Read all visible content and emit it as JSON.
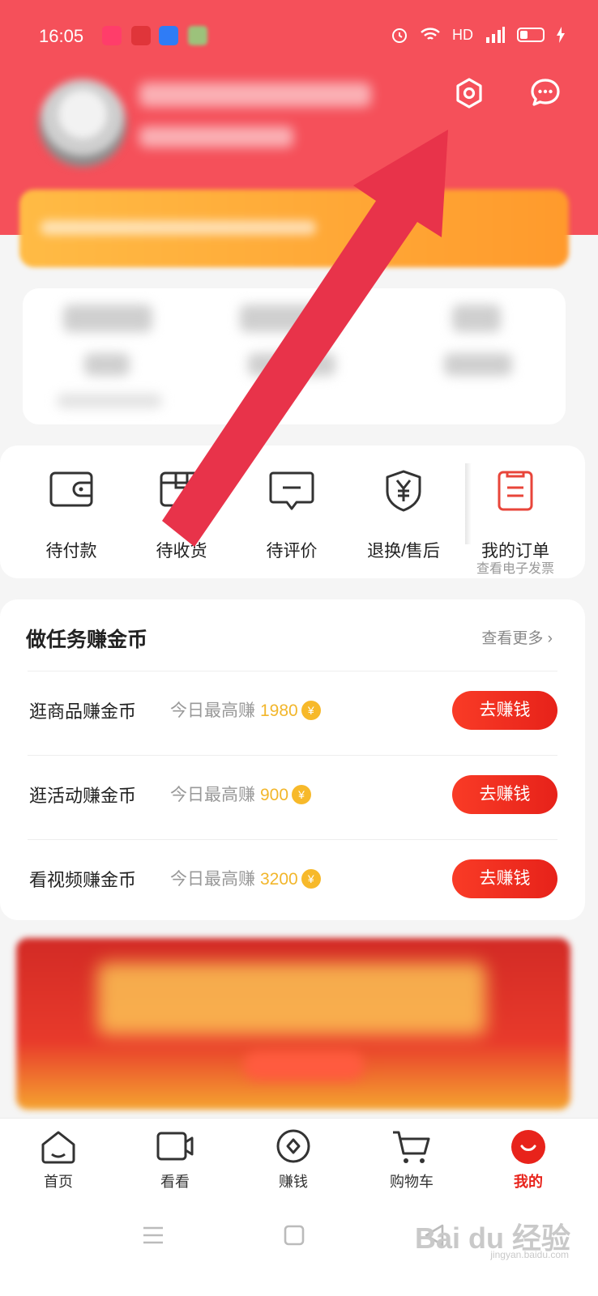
{
  "status_bar": {
    "time": "16:05",
    "hd_label": "HD"
  },
  "orders": {
    "items": [
      {
        "label": "待付款",
        "icon": "wallet-icon"
      },
      {
        "label": "待收货",
        "icon": "package-icon"
      },
      {
        "label": "待评价",
        "icon": "comment-icon"
      },
      {
        "label": "退换/售后",
        "icon": "refund-icon"
      },
      {
        "label": "我的订单",
        "sub": "查看电子发票",
        "icon": "order-list-icon"
      }
    ]
  },
  "tasks": {
    "title": "做任务赚金币",
    "more": "查看更多 ›",
    "sub_prefix": "今日最高赚",
    "coin_glyph": "¥",
    "button_label": "去赚钱",
    "rows": [
      {
        "name": "逛商品赚金币",
        "amount": "1980"
      },
      {
        "name": "逛活动赚金币",
        "amount": "900"
      },
      {
        "name": "看视频赚金币",
        "amount": "3200"
      }
    ]
  },
  "tabbar": {
    "items": [
      {
        "label": "首页",
        "icon": "home-icon"
      },
      {
        "label": "看看",
        "icon": "video-icon"
      },
      {
        "label": "赚钱",
        "icon": "diamond-coin-icon"
      },
      {
        "label": "购物车",
        "icon": "cart-icon"
      },
      {
        "label": "我的",
        "icon": "profile-face-icon",
        "active": true
      }
    ]
  },
  "watermark": {
    "text": "Bai du 经验",
    "sub": "jingyan.baidu.com"
  },
  "colors": {
    "header": "#f5505a",
    "accent": "#e8231b",
    "coin": "#f2b62b",
    "arrow": "#e8334a"
  }
}
